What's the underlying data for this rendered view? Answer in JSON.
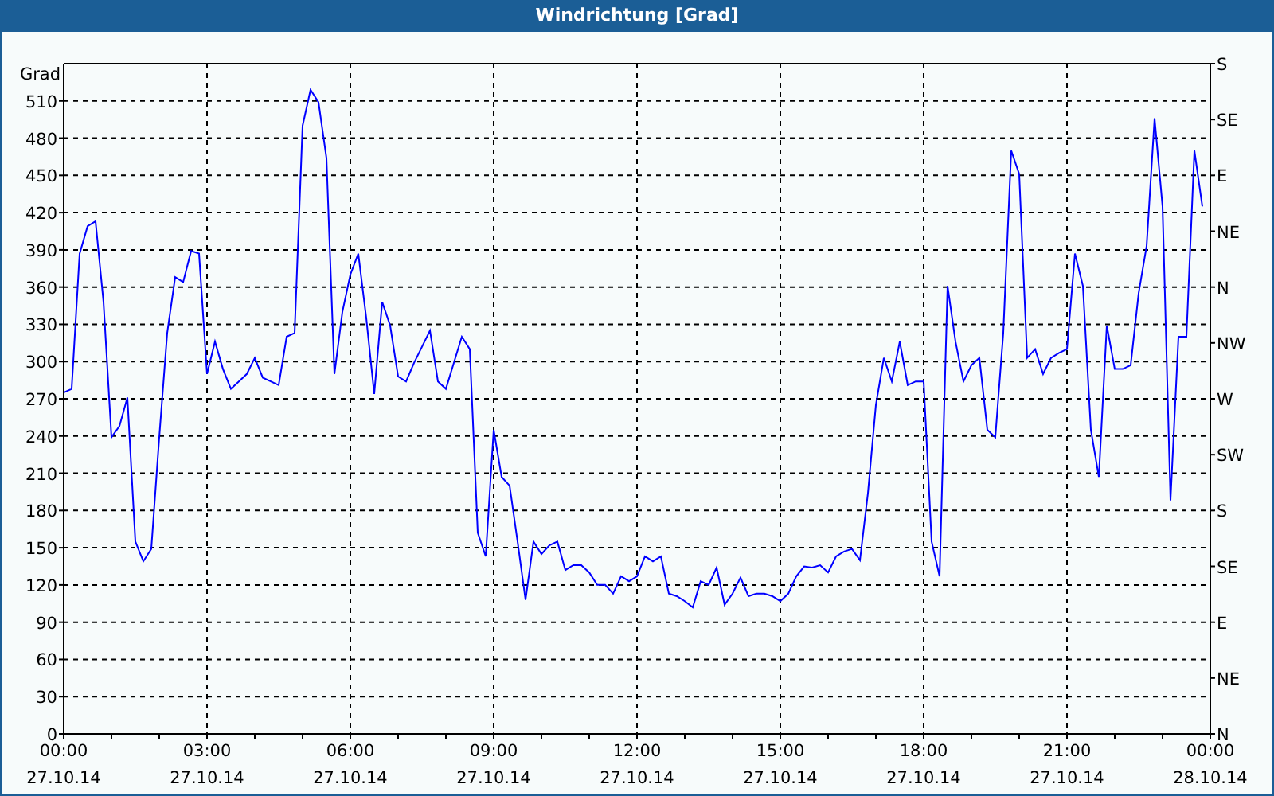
{
  "window": {
    "title": "Windrichtung [Grad]"
  },
  "chart": {
    "chart_data": {
      "type": "line",
      "ylabel": "Grad",
      "categories": [
        "00:00 27.10.14",
        null,
        null,
        null,
        null,
        null,
        null,
        null,
        null,
        null,
        null,
        null,
        null,
        null,
        null,
        null,
        null,
        null,
        "03:00 27.10.14",
        null,
        null,
        null,
        null,
        null,
        null,
        null,
        null,
        null,
        null,
        null,
        null,
        null,
        null,
        null,
        null,
        null,
        "06:00 27.10.14",
        null,
        null,
        null,
        null,
        null,
        null,
        null,
        null,
        null,
        null,
        null,
        null,
        null,
        null,
        null,
        null,
        null,
        "09:00 27.10.14",
        null,
        null,
        null,
        null,
        null,
        null,
        null,
        null,
        null,
        null,
        null,
        null,
        null,
        null,
        null,
        null,
        null,
        "12:00 27.10.14",
        null,
        null,
        null,
        null,
        null,
        null,
        null,
        null,
        null,
        null,
        null,
        null,
        null,
        null,
        null,
        null,
        null,
        "15:00 27.10.14",
        null,
        null,
        null,
        null,
        null,
        null,
        null,
        null,
        null,
        null,
        null,
        null,
        null,
        null,
        null,
        null,
        null,
        "18:00 27.10.14",
        null,
        null,
        null,
        null,
        null,
        null,
        null,
        null,
        null,
        null,
        null,
        null,
        null,
        null,
        null,
        null,
        null,
        "21:00 27.10.14",
        null,
        null,
        null,
        null,
        null,
        null,
        null,
        null,
        null,
        null,
        null,
        null,
        null,
        null,
        null,
        null,
        null,
        "00:00 28.10.14"
      ],
      "series": [
        {
          "color": "#0000ff",
          "values": [
            275,
            278,
            387,
            409,
            413,
            348,
            239,
            248,
            271,
            155,
            139,
            149,
            239,
            323,
            368,
            364,
            389,
            387,
            290,
            316,
            294,
            278,
            284,
            290,
            303,
            287,
            284,
            281,
            320,
            323,
            490,
            519,
            509,
            464,
            290,
            340,
            370,
            387,
            335,
            274,
            348,
            329,
            288,
            284,
            299,
            312,
            325,
            284,
            278,
            299,
            320,
            310,
            162,
            143,
            245,
            207,
            200,
            155,
            108,
            155,
            145,
            152,
            155,
            132,
            136,
            136,
            130,
            120,
            120,
            113,
            127,
            123,
            127,
            143,
            139,
            143,
            113,
            111,
            107,
            102,
            123,
            120,
            134,
            104,
            113,
            126,
            111,
            113,
            113,
            111,
            107,
            113,
            127,
            135,
            134,
            136,
            130,
            143,
            147,
            149,
            140,
            194,
            265,
            303,
            284,
            316,
            281,
            284,
            284,
            155,
            127,
            361,
            316,
            284,
            297,
            303,
            245,
            239,
            323,
            470,
            451,
            303,
            310,
            290,
            303,
            307,
            310,
            387,
            361,
            245,
            207,
            329,
            294,
            294,
            297,
            355,
            393,
            496,
            425,
            188,
            320,
            320,
            470,
            425,
            null
          ]
        }
      ],
      "grid": true,
      "ylim": [
        0,
        540
      ],
      "yticks": [
        0,
        30,
        60,
        90,
        120,
        150,
        180,
        210,
        240,
        270,
        300,
        330,
        360,
        390,
        420,
        450,
        480,
        510
      ]
    },
    "direction_labels": [
      "S",
      "SE",
      "E",
      "NE",
      "N",
      "NW",
      "W",
      "SW",
      "S",
      "SE",
      "E",
      "NE",
      "N"
    ]
  }
}
